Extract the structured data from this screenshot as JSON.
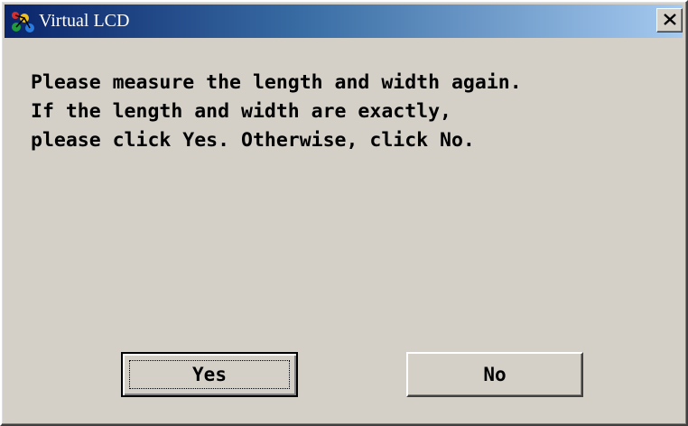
{
  "window": {
    "title": "Virtual LCD",
    "icon": "virtual-lcd-app-icon",
    "close_icon": "close-x-icon",
    "background_color": "#d4d0c8",
    "titlebar_colors": [
      "#0a246a",
      "#a6caf0"
    ]
  },
  "message": {
    "lines": [
      "Please measure the length and width again.",
      "If the length and width are exactly,",
      "please click Yes. Otherwise, click No."
    ]
  },
  "buttons": {
    "yes_label": "Yes",
    "no_label": "No",
    "default": "Yes"
  }
}
